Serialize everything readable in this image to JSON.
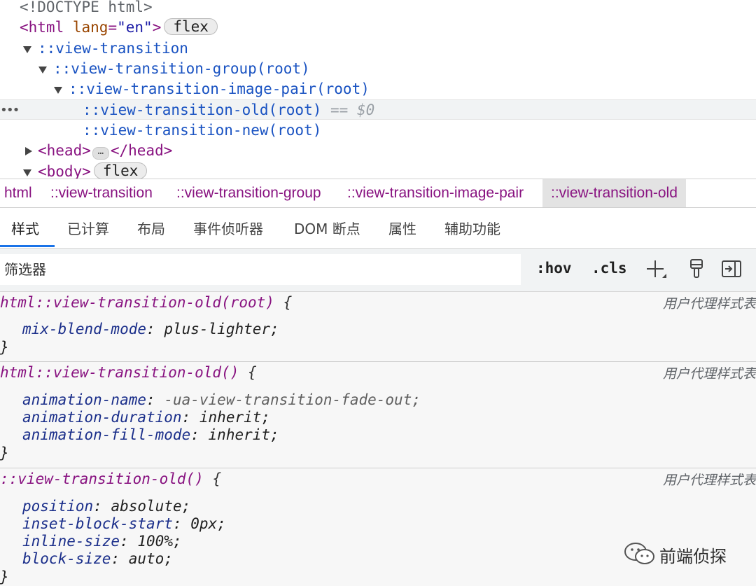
{
  "dom_tree": {
    "doctype": "<!DOCTYPE html>",
    "html_open": "<html",
    "html_attr_name": "lang",
    "html_attr_eq": "=",
    "html_attr_value": "\"en\"",
    "html_close": ">",
    "html_badge": "flex",
    "view_transition": "::view-transition",
    "view_transition_group": "::view-transition-group(root)",
    "view_transition_image_pair": "::view-transition-image-pair(root)",
    "view_transition_old": "::view-transition-old(root)",
    "selected_marker": "== $0",
    "row_dots": "•••",
    "view_transition_new": "::view-transition-new(root)",
    "head_open": "<head>",
    "head_ellipsis": "…",
    "head_close": "</head>",
    "body_open": "<body>",
    "body_badge": "flex"
  },
  "breadcrumbs": [
    "html",
    "::view-transition",
    "::view-transition-group",
    "::view-transition-image-pair",
    "::view-transition-old"
  ],
  "tabs": [
    "样式",
    "已计算",
    "布局",
    "事件侦听器",
    "DOM 断点",
    "属性",
    "辅助功能"
  ],
  "filter": {
    "placeholder": "筛选器",
    "hov_label": ":hov",
    "cls_label": ".cls",
    "icons": [
      "add-rule-icon",
      "paint-brush-icon",
      "toggle-sidebar-icon"
    ]
  },
  "rules": [
    {
      "selector": "html::view-transition-old(root)",
      "open_brace": "{",
      "close_brace": "}",
      "origin": "用户代理样式表",
      "declarations": [
        {
          "name": "mix-blend-mode",
          "value": "plus-lighter;"
        }
      ]
    },
    {
      "selector": "html::view-transition-old()",
      "open_brace": "{",
      "close_brace": "}",
      "origin": "用户代理样式表",
      "declarations": [
        {
          "name": "animation-name",
          "value": "-ua-view-transition-fade-out;"
        },
        {
          "name": "animation-duration",
          "value": "inherit;"
        },
        {
          "name": "animation-fill-mode",
          "value": "inherit;"
        }
      ]
    },
    {
      "selector": "::view-transition-old()",
      "open_brace": "{",
      "close_brace": "}",
      "origin": "用户代理样式表",
      "declarations": [
        {
          "name": "position",
          "value": "absolute;"
        },
        {
          "name": "inset-block-start",
          "value": "0px;"
        },
        {
          "name": "inline-size",
          "value": "100%;"
        },
        {
          "name": "block-size",
          "value": "auto;"
        }
      ]
    }
  ],
  "colon": ":",
  "watermark": {
    "text": "前端侦探",
    "icon": "wechat-icon"
  },
  "colors": {
    "tag": "#881280",
    "pseudo": "#1a53c2",
    "prop_name": "#1a2e8a",
    "active_tab": "#1a73e8"
  }
}
